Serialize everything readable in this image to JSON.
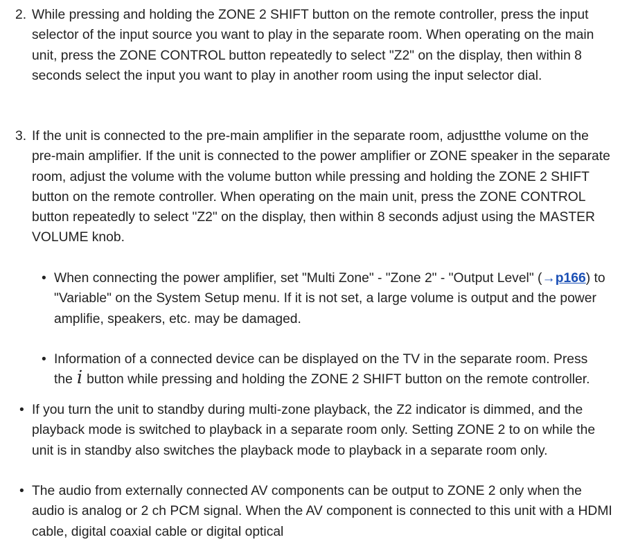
{
  "steps": [
    {
      "num": "2.",
      "text": "While pressing and holding the ZONE 2 SHIFT button on the remote controller, press the input selector of the input source you want to play in the separate room. When operating on the main unit, press the ZONE CONTROL button repeatedly to select \"Z2\" on the display, then within 8 seconds select the input you want to play in another room using the input selector dial."
    },
    {
      "num": "3.",
      "text": "If the unit is connected to the pre-main amplifier in the separate room, adjustthe volume on the pre-main amplifier. If the unit is connected to the power amplifier or ZONE speaker in the separate room, adjust the volume with the volume button while pressing and holding the ZONE 2 SHIFT button on the remote controller. When operating on the main unit, press the ZONE CONTROL button repeatedly to select \"Z2\" on the display, then within 8 seconds adjust using the MASTER VOLUME knob."
    }
  ],
  "sub_notes": {
    "note1_before": "When connecting the power amplifier, set \"Multi Zone\" - \"Zone 2\" - \"Output Level\" (",
    "note1_arrow": "→",
    "note1_link": "p166",
    "note1_after": ") to \"Variable\" on the System Setup menu. If it is not set, a large volume is output and the power amplifie, speakers, etc. may be damaged.",
    "note2_before": "Information of a connected device can be displayed on the TV in the separate room. Press the",
    "note2_icon": "i",
    "note2_after": "button while pressing and holding the ZONE 2 SHIFT button on the remote controller."
  },
  "notes": [
    "If you turn the unit to standby during multi-zone playback, the Z2 indicator is dimmed, and the playback mode is switched to playback in a separate room only. Setting ZONE 2 to on while the unit is in standby also switches the playback mode to playback in a separate room only.",
    "The audio from externally connected AV components can be output to ZONE 2 only when the audio is analog or 2 ch PCM signal. When the AV component is connected to this unit with a HDMI cable, digital coaxial cable or digital optical"
  ],
  "bullet": "•",
  "colors": {
    "text": "#222222",
    "link": "#1a4fb5"
  }
}
